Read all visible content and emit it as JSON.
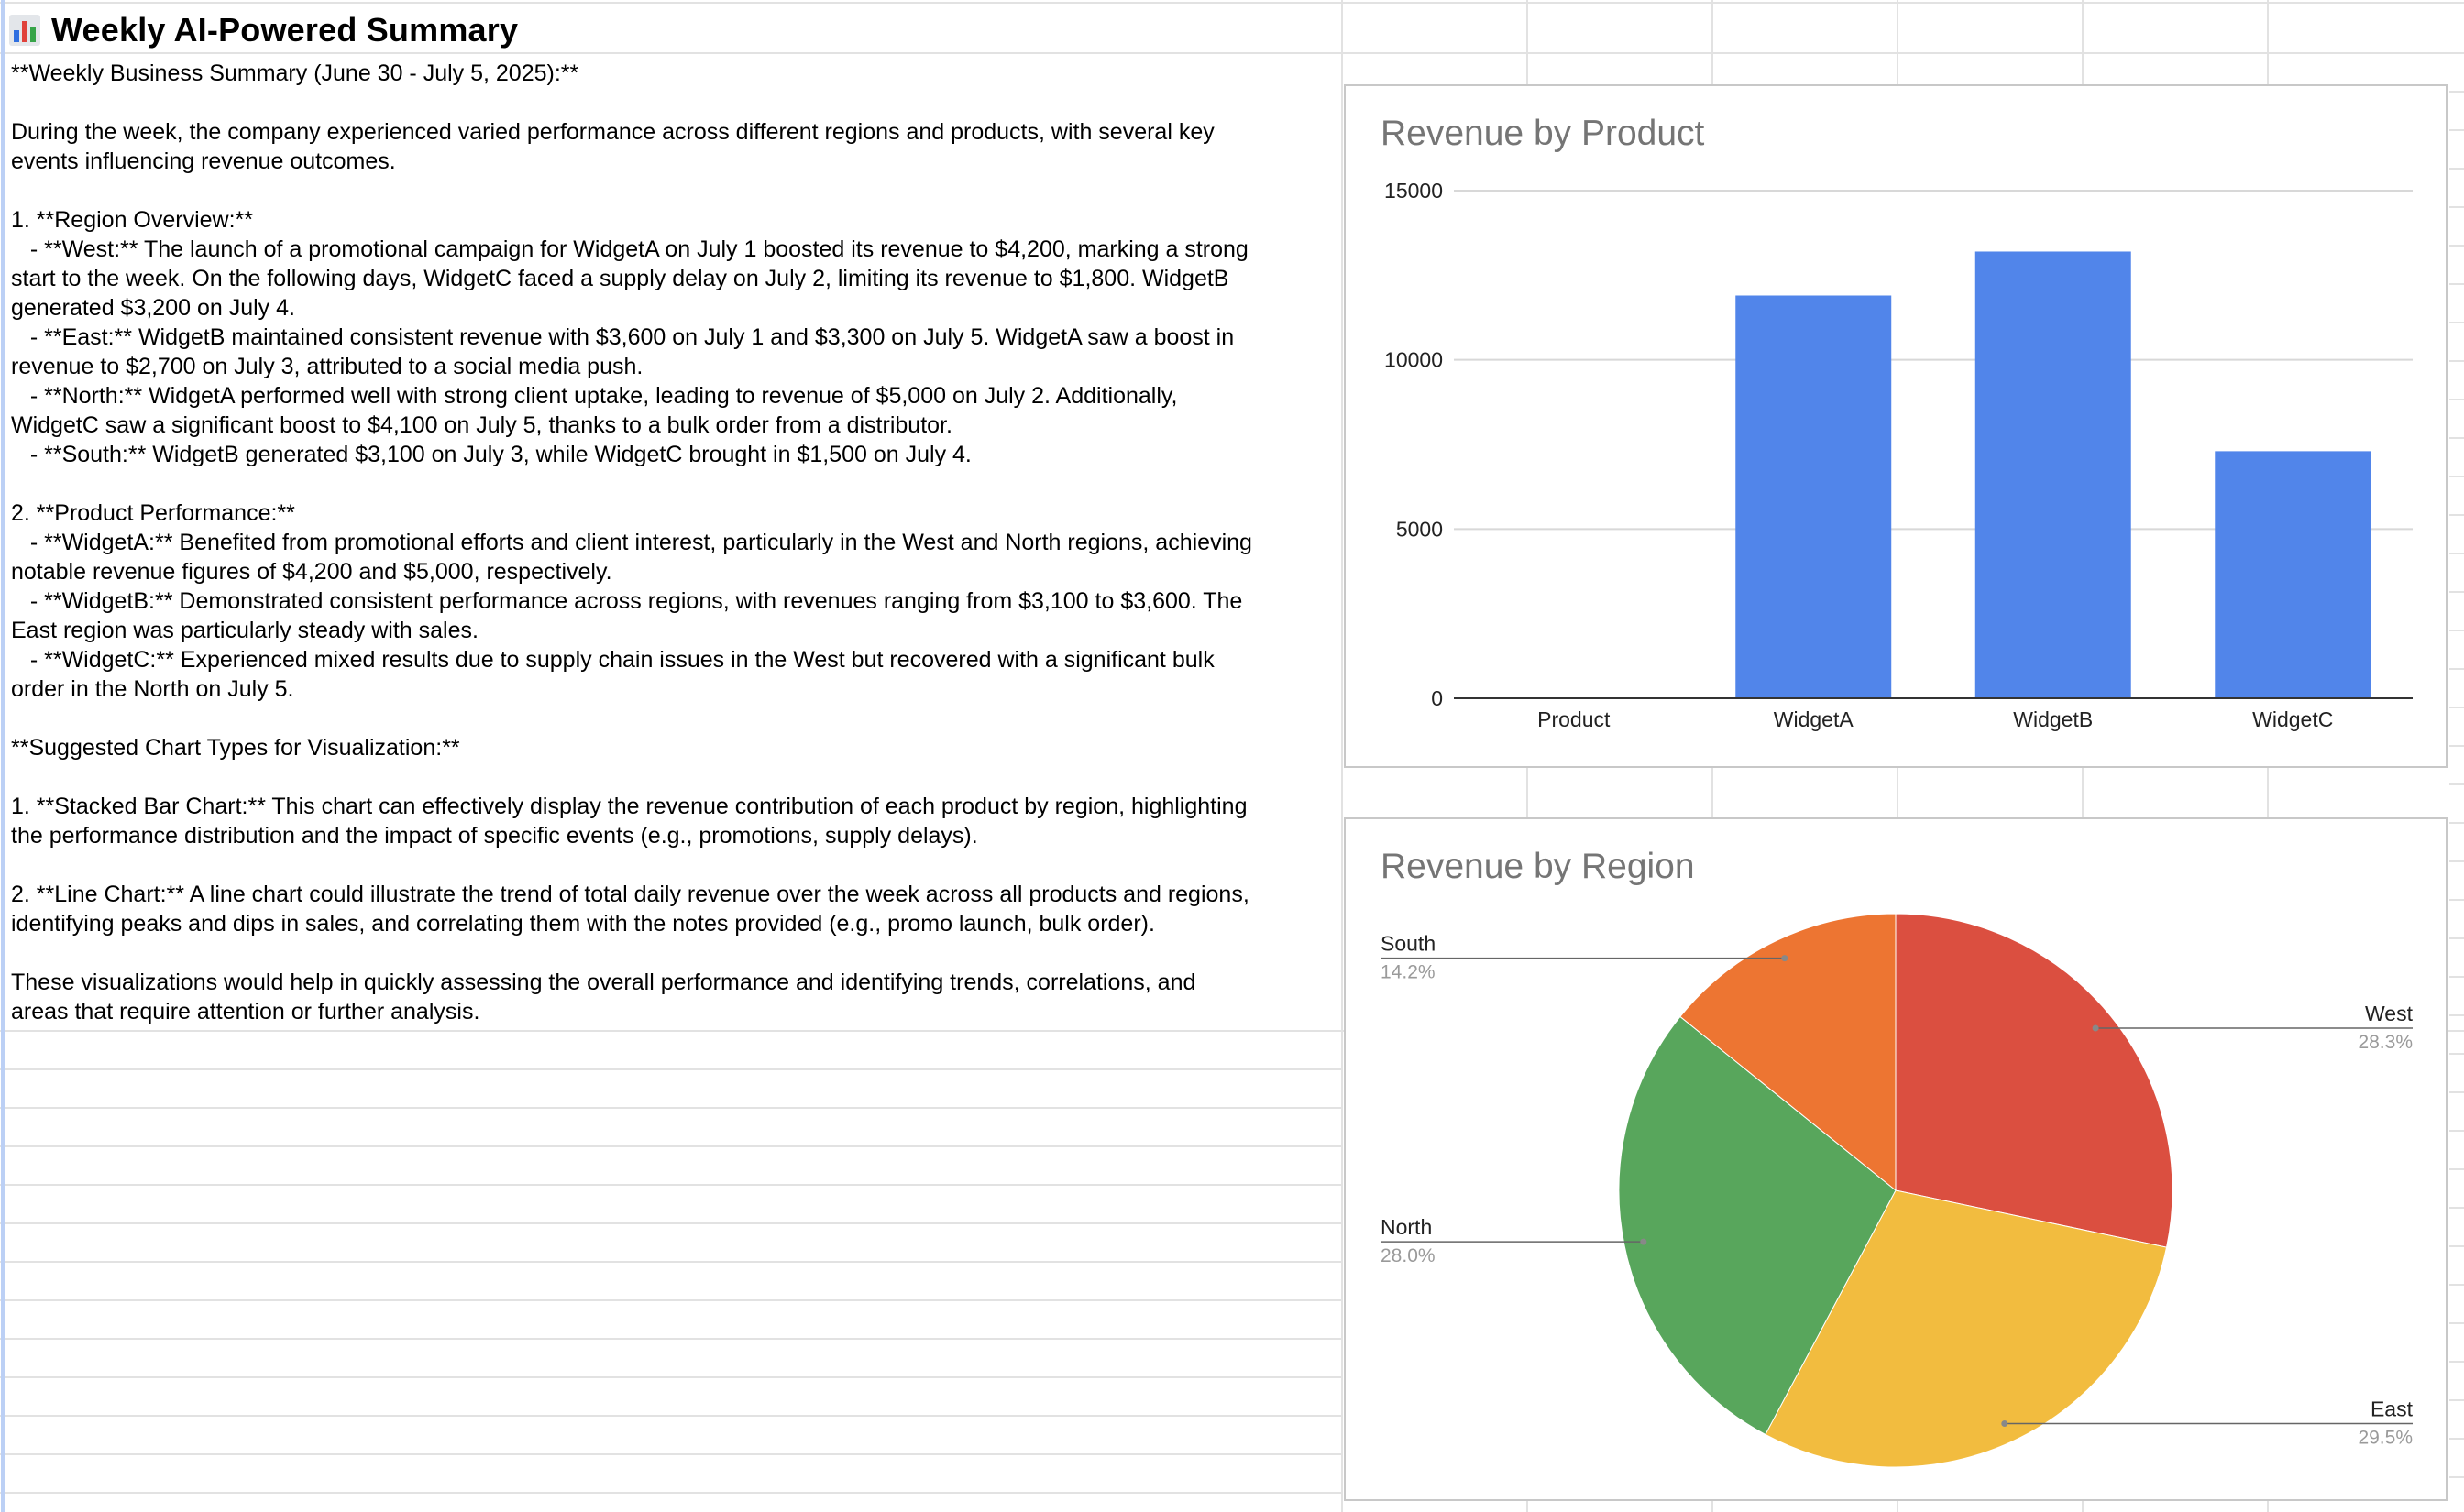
{
  "header": {
    "title": "Weekly AI-Powered Summary",
    "icon": "bar-chart-icon"
  },
  "summary": {
    "lines": [
      "**Weekly Business Summary (June 30 - July 5, 2025):**",
      "",
      "During the week, the company experienced varied performance across different regions and products, with several key",
      "events influencing revenue outcomes.",
      "",
      "1. **Region Overview:**",
      "   - **West:** The launch of a promotional campaign for WidgetA on July 1 boosted its revenue to $4,200, marking a strong",
      "start to the week. On the following days, WidgetC faced a supply delay on July 2, limiting its revenue to $1,800. WidgetB",
      "generated $3,200 on July 4.",
      "   - **East:** WidgetB maintained consistent revenue with $3,600 on July 1 and $3,300 on July 5. WidgetA saw a boost in",
      "revenue to $2,700 on July 3, attributed to a social media push.",
      "   - **North:** WidgetA performed well with strong client uptake, leading to revenue of $5,000 on July 2. Additionally,",
      "WidgetC saw a significant boost to $4,100 on July 5, thanks to a bulk order from a distributor.",
      "   - **South:** WidgetB generated $3,100 on July 3, while WidgetC brought in $1,500 on July 4.",
      "",
      "2. **Product Performance:**",
      "   - **WidgetA:** Benefited from promotional efforts and client interest, particularly in the West and North regions, achieving",
      "notable revenue figures of $4,200 and $5,000, respectively.",
      "   - **WidgetB:** Demonstrated consistent performance across regions, with revenues ranging from $3,100 to $3,600. The",
      "East region was particularly steady with sales.",
      "   - **WidgetC:** Experienced mixed results due to supply chain issues in the West but recovered with a significant bulk",
      "order in the North on July 5.",
      "",
      "**Suggested Chart Types for Visualization:**",
      "",
      "1. **Stacked Bar Chart:** This chart can effectively display the revenue contribution of each product by region, highlighting",
      "the performance distribution and the impact of specific events (e.g., promotions, supply delays).",
      "",
      "2. **Line Chart:** A line chart could illustrate the trend of total daily revenue over the week across all products and regions,",
      "identifying peaks and dips in sales, and correlating them with the notes provided (e.g., promo launch, bulk order).",
      "",
      "These visualizations would help in quickly assessing the overall performance and identifying trends, correlations, and",
      "areas that require attention or further analysis."
    ]
  },
  "charts": {
    "product": {
      "title": "Revenue by Product"
    },
    "region": {
      "title": "Revenue by Region"
    }
  },
  "chart_data": [
    {
      "type": "bar",
      "title": "Revenue by Product",
      "categories": [
        "Product",
        "WidgetA",
        "WidgetB",
        "WidgetC"
      ],
      "values": [
        0,
        11900,
        13200,
        7300
      ],
      "ylim": [
        0,
        15000
      ],
      "yticks": [
        0,
        5000,
        10000,
        15000
      ],
      "grid": true,
      "legend": "none",
      "color": "#5185ea"
    },
    {
      "type": "pie",
      "title": "Revenue by Region",
      "slices": [
        {
          "label": "West",
          "percent_label": "28.3%",
          "value": 28.3,
          "color": "#db4f40"
        },
        {
          "label": "East",
          "percent_label": "29.5%",
          "value": 29.5,
          "color": "#f2bc3f"
        },
        {
          "label": "North",
          "percent_label": "28.0%",
          "value": 28.0,
          "color": "#58a65c"
        },
        {
          "label": "South",
          "percent_label": "14.2%",
          "value": 14.2,
          "color": "#ed7532"
        }
      ],
      "start": "top, clockwise",
      "legend": "labels with leader lines"
    }
  ]
}
